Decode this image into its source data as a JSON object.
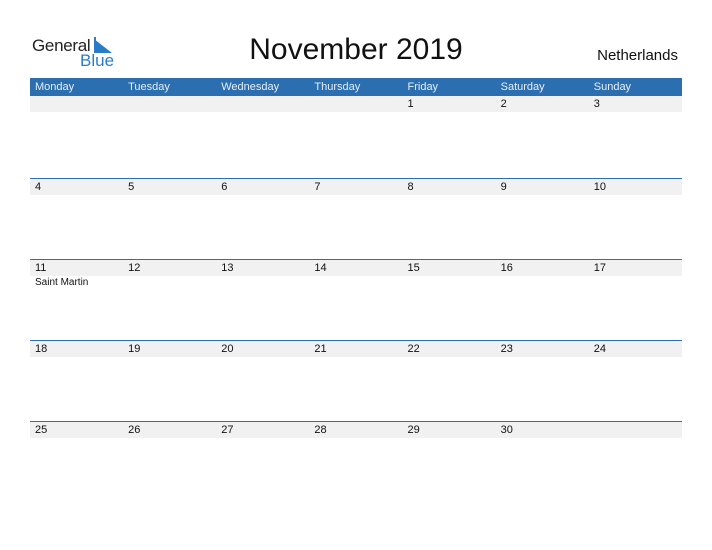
{
  "logo": {
    "general": "General",
    "blue": "Blue"
  },
  "title": "November 2019",
  "country": "Netherlands",
  "colors": {
    "accent": "#2c6fb0",
    "band": "#f1f1f1",
    "logo_blue": "#2a7cc7"
  },
  "weekdays": [
    "Monday",
    "Tuesday",
    "Wednesday",
    "Thursday",
    "Friday",
    "Saturday",
    "Sunday"
  ],
  "weeks": [
    {
      "days": [
        "",
        "",
        "",
        "",
        "1",
        "2",
        "3"
      ],
      "events": [
        "",
        "",
        "",
        "",
        "",
        "",
        ""
      ]
    },
    {
      "days": [
        "4",
        "5",
        "6",
        "7",
        "8",
        "9",
        "10"
      ],
      "events": [
        "",
        "",
        "",
        "",
        "",
        "",
        ""
      ]
    },
    {
      "days": [
        "11",
        "12",
        "13",
        "14",
        "15",
        "16",
        "17"
      ],
      "events": [
        "Saint Martin",
        "",
        "",
        "",
        "",
        "",
        ""
      ]
    },
    {
      "days": [
        "18",
        "19",
        "20",
        "21",
        "22",
        "23",
        "24"
      ],
      "events": [
        "",
        "",
        "",
        "",
        "",
        "",
        ""
      ]
    },
    {
      "days": [
        "25",
        "26",
        "27",
        "28",
        "29",
        "30",
        ""
      ],
      "events": [
        "",
        "",
        "",
        "",
        "",
        "",
        ""
      ]
    }
  ]
}
